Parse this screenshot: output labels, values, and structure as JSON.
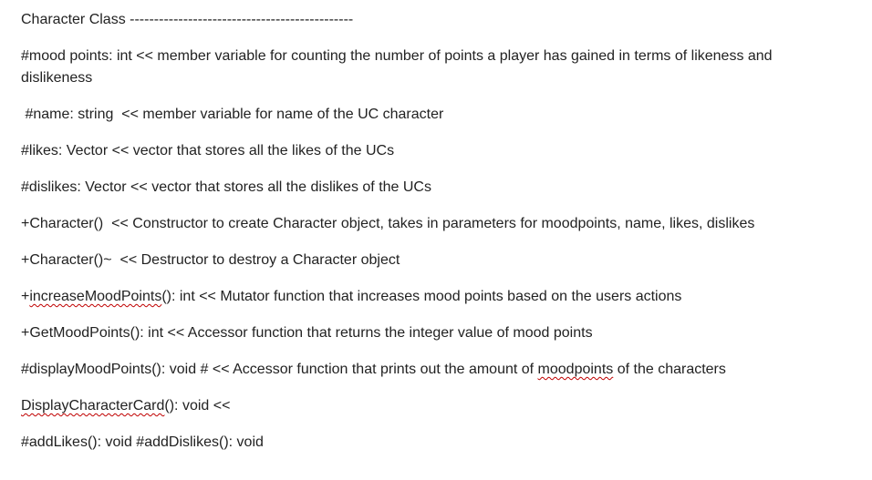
{
  "document": {
    "heading": "Character Class ----------------------------------------------",
    "lines": [
      "#mood points: int << member variable for counting the  number of points a player has gained in terms of likeness and dislikeness",
      " #name: string  << member variable for name of the UC character",
      "#likes: Vector << vector that stores all the likes of the UCs",
      "#dislikes: Vector << vector that stores all the dislikes of the UCs",
      "+Character()  << Constructor to create Character object, takes in parameters for moodpoints, name, likes, dislikes",
      "+Character()~  << Destructor to destroy a Character object",
      {
        "pre": "+",
        "flagged": "increaseMoodPoints",
        "post": "(): int << Mutator function that increases mood points based on the users actions"
      },
      "+GetMoodPoints(): int << Accessor function that returns the integer value of mood points",
      {
        "pre": "#displayMoodPoints(): void # << Accessor function that prints out the amount of ",
        "flagged": "moodpoints",
        "post": " of the characters"
      },
      {
        "pre": "",
        "flagged": "DisplayCharacterCard",
        "post": "(): void <<"
      },
      "#addLikes(): void #addDislikes(): void"
    ]
  }
}
